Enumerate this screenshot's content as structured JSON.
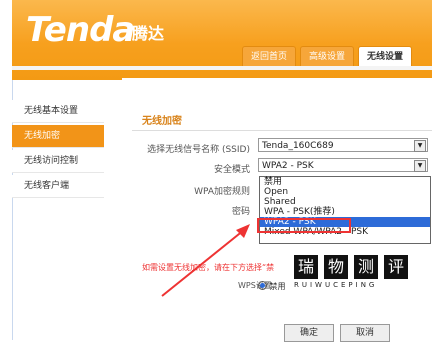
{
  "brand": {
    "logo": "Tenda",
    "logo_cn": "腾达"
  },
  "tabs": [
    {
      "label": "返回首页",
      "active": false
    },
    {
      "label": "高级设置",
      "active": false
    },
    {
      "label": "无线设置",
      "active": true
    }
  ],
  "sidebar": {
    "items": [
      {
        "label": "无线基本设置",
        "active": false
      },
      {
        "label": "无线加密",
        "active": true
      },
      {
        "label": "无线访问控制",
        "active": false
      },
      {
        "label": "无线客户端",
        "active": false
      }
    ]
  },
  "main": {
    "section_title": "无线加密",
    "ssid_label": "选择无线信号名称 (SSID)",
    "ssid_value": "Tenda_160C689",
    "security_label": "安全模式",
    "security_value": "WPA2 - PSK",
    "wpa_rule_label": "WPA加密规则",
    "password_label": "密码",
    "dropdown_options": [
      "禁用",
      "Open",
      "Shared",
      "WPA - PSK(推荐)",
      "WPA2 - PSK",
      "Mixed WPA/WPA2 - PSK"
    ],
    "selected_option": "WPA2 - PSK",
    "warning": "如需设置无线加密，请在下方选择“禁",
    "wps_label": "WPS设置",
    "wps_value": "禁用",
    "ok_button": "确定",
    "cancel_button": "取消"
  },
  "watermark": {
    "chars": [
      "瑞",
      "物",
      "测",
      "评"
    ],
    "sub": "RUIWUCEPING"
  },
  "colors": {
    "brand_orange": "#f39a14",
    "title_orange": "#d9841c",
    "highlight_blue": "#2d6bd8",
    "annotation_red": "#e33333"
  }
}
